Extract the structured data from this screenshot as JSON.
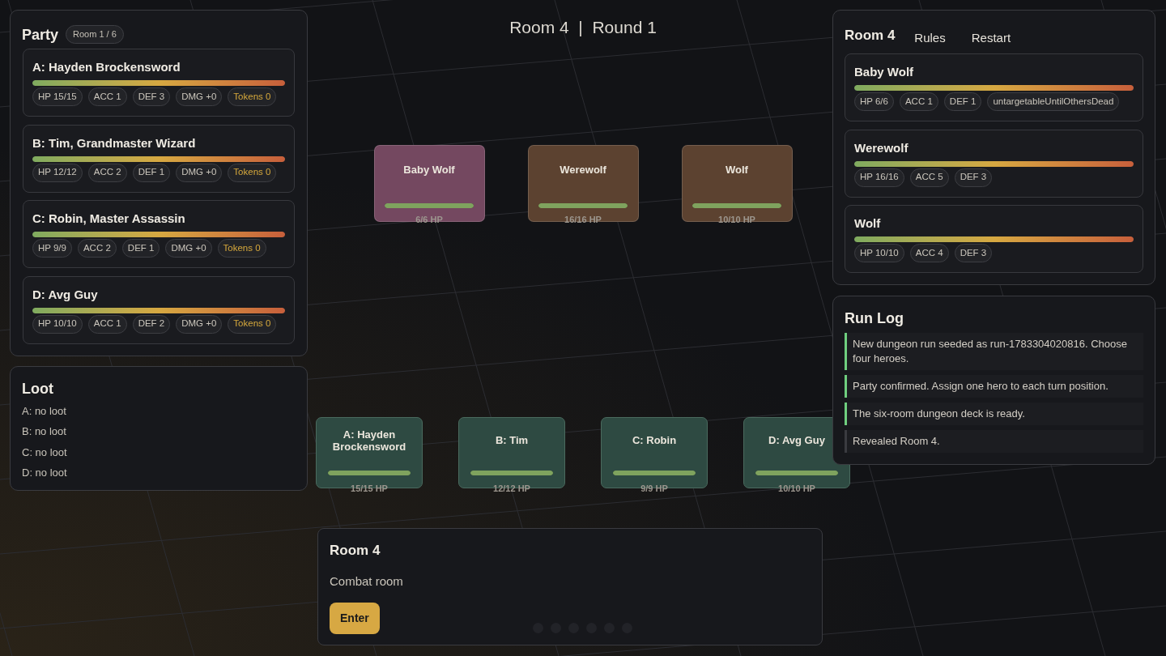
{
  "party_panel": {
    "title": "Party",
    "room_badge": "Room 1 / 6",
    "heroes": [
      {
        "name": "A: Hayden Brockensword",
        "health_bar": {
          "level": 1
        },
        "stats": [
          {
            "text": "HP 15/15",
            "kind": "stat"
          },
          {
            "text": "ACC 1",
            "kind": "stat"
          },
          {
            "text": "DEF 3",
            "kind": "stat"
          },
          {
            "text": "DMG +0",
            "kind": "stat"
          },
          {
            "text": "Tokens 0",
            "kind": "tokens"
          }
        ]
      },
      {
        "name": "B: Tim, Grandmaster Wizard",
        "health_bar": {
          "level": 1
        },
        "stats": [
          {
            "text": "HP 12/12",
            "kind": "stat"
          },
          {
            "text": "ACC 2",
            "kind": "stat"
          },
          {
            "text": "DEF 1",
            "kind": "stat"
          },
          {
            "text": "DMG +0",
            "kind": "stat"
          },
          {
            "text": "Tokens 0",
            "kind": "tokens"
          }
        ]
      },
      {
        "name": "C: Robin, Master Assassin",
        "health_bar": {
          "level": 1
        },
        "stats": [
          {
            "text": "HP 9/9",
            "kind": "stat"
          },
          {
            "text": "ACC 2",
            "kind": "stat"
          },
          {
            "text": "DEF 1",
            "kind": "stat"
          },
          {
            "text": "DMG +0",
            "kind": "stat"
          },
          {
            "text": "Tokens 0",
            "kind": "tokens"
          }
        ]
      },
      {
        "name": "D: Avg Guy",
        "health_bar": {
          "level": 1
        },
        "stats": [
          {
            "text": "HP 10/10",
            "kind": "stat"
          },
          {
            "text": "ACC 1",
            "kind": "stat"
          },
          {
            "text": "DEF 2",
            "kind": "stat"
          },
          {
            "text": "DMG +0",
            "kind": "stat"
          },
          {
            "text": "Tokens 0",
            "kind": "tokens"
          }
        ]
      }
    ]
  },
  "loot_panel": {
    "title": "Loot",
    "items": [
      "A: no loot",
      "B: no loot",
      "C: no loot",
      "D: no loot"
    ]
  },
  "board": {
    "title": "Room 4  |  Round 1",
    "enemies": [
      {
        "name": "Baby Wolf",
        "color": "#744860",
        "health_bar": {
          "level": 1
        },
        "hp": "6/6 HP"
      },
      {
        "name": "Werewolf",
        "color": "#5c4230",
        "health_bar": {
          "level": 1
        },
        "hp": "16/16 HP"
      },
      {
        "name": "Wolf",
        "color": "#5c4230",
        "health_bar": {
          "level": 1
        },
        "hp": "10/10 HP"
      }
    ],
    "heroes": [
      {
        "name": "A: Hayden Brockensword",
        "health_bar": {
          "level": 1
        },
        "hp": "15/15 HP"
      },
      {
        "name": "B: Tim",
        "health_bar": {
          "level": 1
        },
        "hp": "12/12 HP"
      },
      {
        "name": "C: Robin",
        "health_bar": {
          "level": 1
        },
        "hp": "9/9 HP"
      },
      {
        "name": "D: Avg Guy",
        "health_bar": {
          "level": 1
        },
        "hp": "10/10 HP"
      }
    ]
  },
  "room_card": {
    "title": "Room 4",
    "description": "Combat room",
    "action": "Enter"
  },
  "encounter_panel": {
    "title": "Room 4",
    "buttons": [
      "Rules",
      "Restart"
    ],
    "enemies": [
      {
        "name": "Baby Wolf",
        "health_bar": {
          "level": 1
        },
        "stats": [
          {
            "text": "HP 6/6",
            "kind": "stat"
          },
          {
            "text": "ACC 1",
            "kind": "stat"
          },
          {
            "text": "DEF 1",
            "kind": "stat"
          },
          {
            "text": "untargetableUntilOthersDead",
            "kind": "stat"
          }
        ]
      },
      {
        "name": "Werewolf",
        "health_bar": {
          "level": 1
        },
        "stats": [
          {
            "text": "HP 16/16",
            "kind": "stat"
          },
          {
            "text": "ACC 5",
            "kind": "stat"
          },
          {
            "text": "DEF 3",
            "kind": "stat"
          }
        ]
      },
      {
        "name": "Wolf",
        "health_bar": {
          "level": 1
        },
        "stats": [
          {
            "text": "HP 10/10",
            "kind": "stat"
          },
          {
            "text": "ACC 4",
            "kind": "stat"
          },
          {
            "text": "DEF 3",
            "kind": "stat"
          }
        ]
      }
    ]
  },
  "run_log": {
    "title": "Run Log",
    "entries": [
      {
        "text": "New dungeon run seeded as run-1783304020816. Choose four heroes.",
        "color": "#6fcf7f"
      },
      {
        "text": "Party confirmed. Assign one hero to each turn position.",
        "color": "#6fcf7f"
      },
      {
        "text": "The six-room dungeon deck is ready.",
        "color": "#6fcf7f"
      },
      {
        "text": "Revealed Room 4.",
        "color": "#3a3b40"
      }
    ]
  }
}
